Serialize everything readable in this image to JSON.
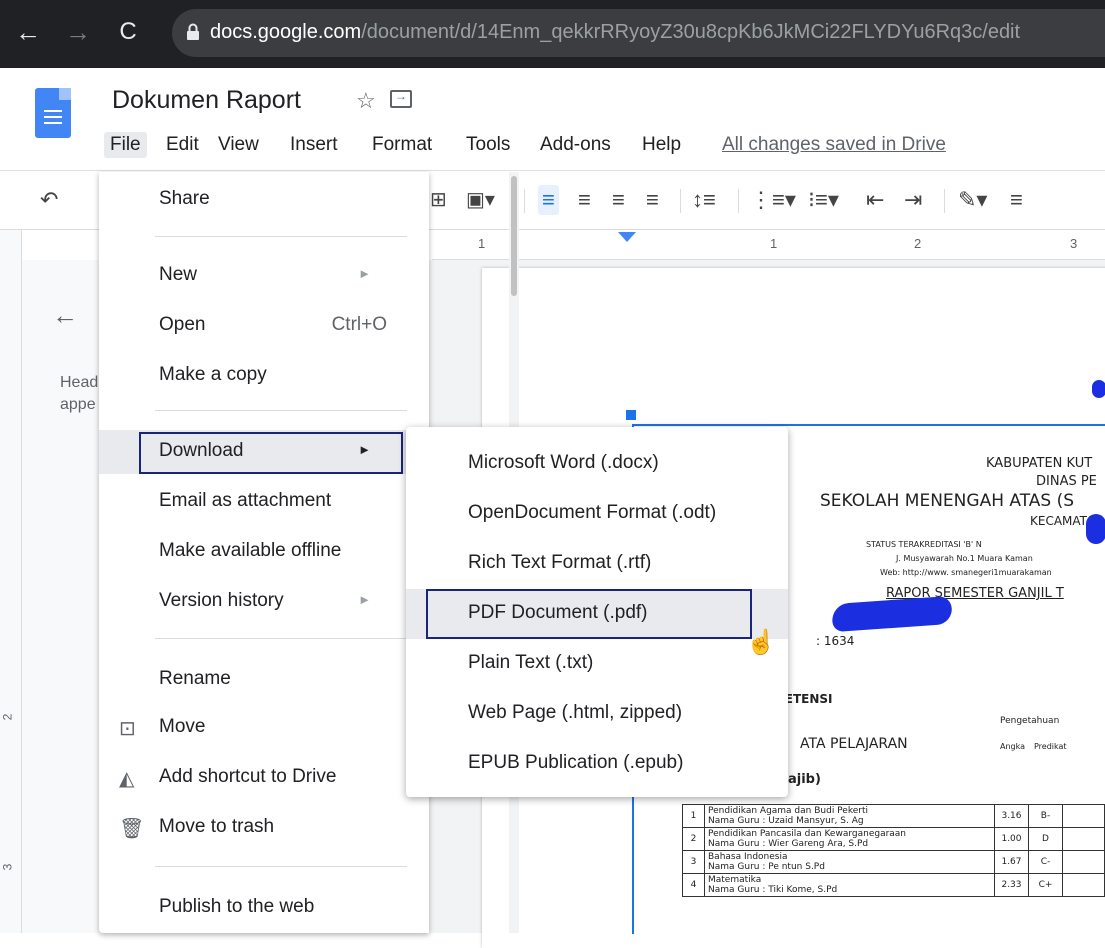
{
  "browser": {
    "url_host": "docs.google.com",
    "url_path": "/document/d/14Enm_qekkrRRyoyZ30u8cpKb6JkMCi22FLYDYu6Rq3c/edit"
  },
  "doc": {
    "title": "Dokumen Raport",
    "saved_status": "All changes saved in Drive"
  },
  "menubar": [
    "File",
    "Edit",
    "View",
    "Insert",
    "Format",
    "Tools",
    "Add-ons",
    "Help"
  ],
  "file_menu": {
    "share": "Share",
    "new": "New",
    "open": "Open",
    "open_shortcut": "Ctrl+O",
    "make_copy": "Make a copy",
    "download": "Download",
    "email": "Email as attachment",
    "offline": "Make available offline",
    "version_history": "Version history",
    "rename": "Rename",
    "move": "Move",
    "add_shortcut": "Add shortcut to Drive",
    "trash": "Move to trash",
    "publish": "Publish to the web"
  },
  "download_menu": [
    "Microsoft Word (.docx)",
    "OpenDocument Format (.odt)",
    "Rich Text Format (.rtf)",
    "PDF Document (.pdf)",
    "Plain Text (.txt)",
    "Web Page (.html, zipped)",
    "EPUB Publication (.epub)"
  ],
  "outline": {
    "text1": "Head",
    "text2": "appe"
  },
  "ruler": {
    "n1": "1",
    "n2": "1",
    "n3": "2",
    "n4": "3"
  },
  "left_ruler": {
    "n1": "2",
    "n2": "3"
  },
  "rapor": {
    "line1": "KABUPATEN KUT",
    "line2": "DINAS PE",
    "line3": "SEKOLAH MENENGAH ATAS (S",
    "line4": "KECAMATA",
    "line5": "STATUS TERAKREDITASI 'B'    N",
    "line6": "J. Musyawarah No.1 Muara Kaman",
    "line7": "Web: http://www. smanegeri1muarakaman",
    "line8": "RAPOR SEMESTER GANJIL T",
    "nis": ": 1634",
    "kompetensi": "PETENSI",
    "mapel": "ATA PELAJARAN",
    "wajib": "ajib)",
    "pengetahuan": "Pengetahuan",
    "angka": "Angka",
    "predikat": "Predikat"
  },
  "grades": [
    {
      "no": "1",
      "subject": "Pendidikan Agama dan Budi Pekerti",
      "teacher": "Nama Guru : Uzaid Mansyur, S. Ag",
      "score": "3.16",
      "grade": "B-"
    },
    {
      "no": "2",
      "subject": "Pendidikan Pancasila dan Kewarganegaraan",
      "teacher": "Nama Guru : Wier Gareng Ara, S.Pd",
      "score": "1.00",
      "grade": "D"
    },
    {
      "no": "3",
      "subject": "Bahasa Indonesia",
      "teacher": "Nama Guru : Pe ntun S.Pd",
      "score": "1.67",
      "grade": "C-"
    },
    {
      "no": "4",
      "subject": "Matematika",
      "teacher": "Nama Guru : Tiki Kome, S.Pd",
      "score": "2.33",
      "grade": "C+"
    }
  ]
}
